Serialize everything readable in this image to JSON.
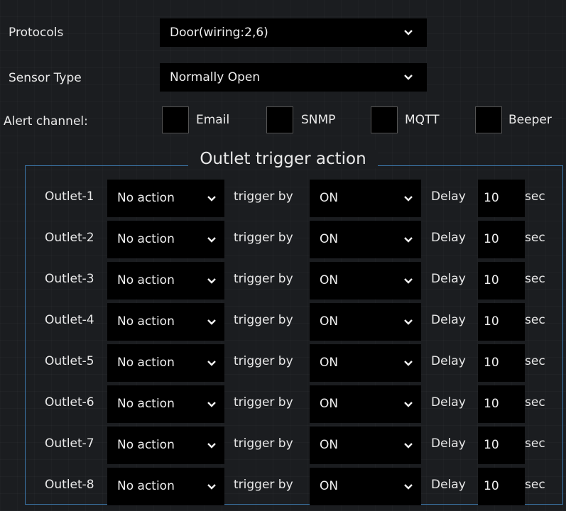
{
  "protocols": {
    "label": "Protocols",
    "value": "Door(wiring:2,6)"
  },
  "sensor_type": {
    "label": "Sensor Type",
    "value": "Normally Open"
  },
  "alert_channel": {
    "label": "Alert channel:",
    "options": [
      {
        "label": "Email",
        "checked": false
      },
      {
        "label": "SNMP",
        "checked": false
      },
      {
        "label": "MQTT",
        "checked": false
      },
      {
        "label": "Beeper",
        "checked": false
      }
    ]
  },
  "outlet_section": {
    "title": "Outlet trigger action",
    "trigger_label": "trigger by",
    "delay_label": "Delay",
    "unit_label": "sec",
    "rows": [
      {
        "name": "Outlet-1",
        "action": "No action",
        "trigger": "ON",
        "delay": "10"
      },
      {
        "name": "Outlet-2",
        "action": "No action",
        "trigger": "ON",
        "delay": "10"
      },
      {
        "name": "Outlet-3",
        "action": "No action",
        "trigger": "ON",
        "delay": "10"
      },
      {
        "name": "Outlet-4",
        "action": "No action",
        "trigger": "ON",
        "delay": "10"
      },
      {
        "name": "Outlet-5",
        "action": "No action",
        "trigger": "ON",
        "delay": "10"
      },
      {
        "name": "Outlet-6",
        "action": "No action",
        "trigger": "ON",
        "delay": "10"
      },
      {
        "name": "Outlet-7",
        "action": "No action",
        "trigger": "ON",
        "delay": "10"
      },
      {
        "name": "Outlet-8",
        "action": "No action",
        "trigger": "ON",
        "delay": "10"
      }
    ]
  },
  "colors": {
    "background": "#1b1d20",
    "field": "#000000",
    "border": "#3d79ad",
    "text": "#e9e9e9"
  }
}
